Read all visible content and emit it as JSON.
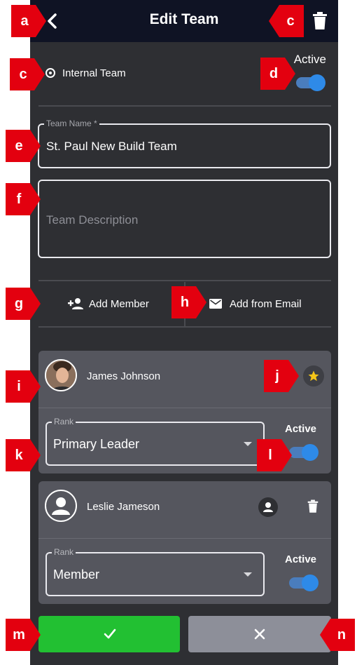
{
  "header": {
    "title": "Edit Team"
  },
  "team": {
    "type_label": "Internal Team",
    "active_label": "Active",
    "active": true,
    "name_legend": "Team Name *",
    "name_value": "St. Paul New Build Team",
    "description_placeholder": "Team Description"
  },
  "actions": {
    "add_member": "Add Member",
    "add_from_email": "Add from Email"
  },
  "members": [
    {
      "name": "James Johnson",
      "rank_legend": "Rank",
      "rank": "Primary Leader",
      "active_label": "Active",
      "active": true,
      "primary_star": true
    },
    {
      "name": "Leslie Jameson",
      "rank_legend": "Rank",
      "rank": "Member",
      "active_label": "Active",
      "active": true,
      "primary_star": false
    }
  ],
  "markers": {
    "a": "a",
    "c1": "c",
    "c2": "c",
    "d": "d",
    "e": "e",
    "f": "f",
    "g": "g",
    "h": "h",
    "i": "i",
    "j": "j",
    "k": "k",
    "l": "l",
    "m": "m",
    "n": "n"
  },
  "colors": {
    "header_bg": "#0f1324",
    "panel_bg": "#2e2f33",
    "card_bg": "#55565e",
    "toggle_on": "#2e8ae8",
    "confirm": "#22c032",
    "cancel": "#8d8f99",
    "marker": "#e3000f",
    "star": "#f5c518"
  },
  "icons": {
    "back": "chevron-left-icon",
    "delete": "trash-icon",
    "radio": "radio-selected-icon",
    "add_person": "person-add-icon",
    "email": "mail-icon",
    "star": "star-icon",
    "person": "person-icon",
    "confirm": "check-icon",
    "cancel": "close-icon"
  }
}
